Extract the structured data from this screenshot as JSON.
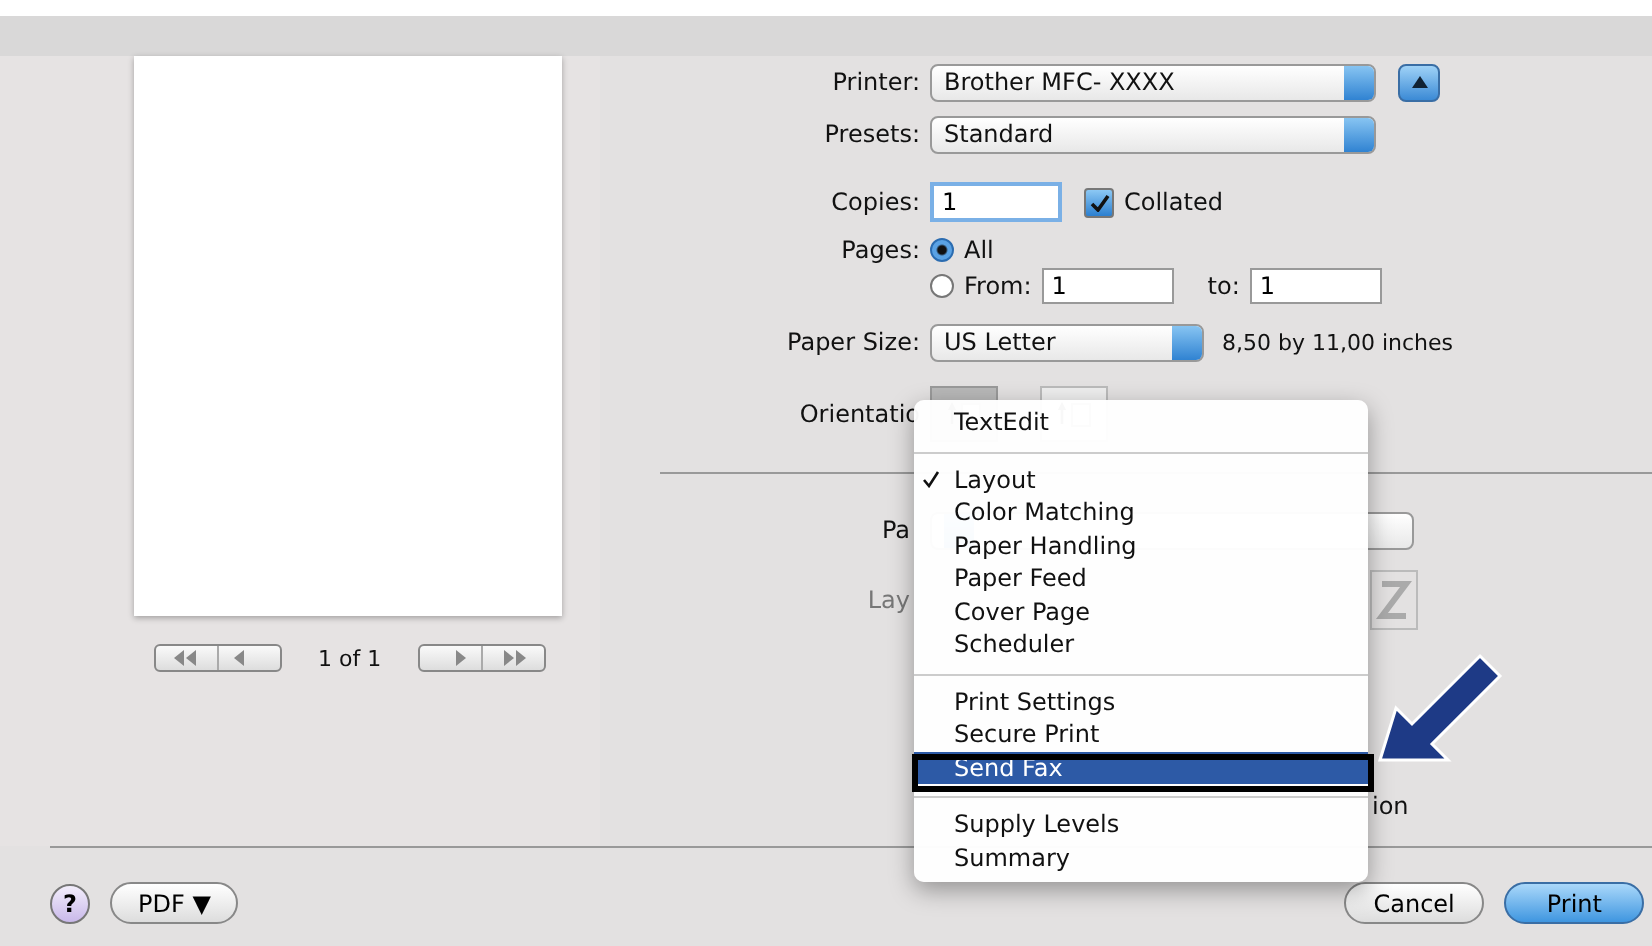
{
  "preview": {
    "page_indicator": "1 of 1"
  },
  "printer": {
    "label": "Printer:",
    "value": "Brother MFC- XXXX"
  },
  "presets": {
    "label": "Presets:",
    "value": "Standard"
  },
  "copies": {
    "label": "Copies:",
    "value": "1",
    "collated": {
      "label": "Collated",
      "checked": true
    }
  },
  "pages": {
    "label": "Pages:",
    "options": [
      {
        "label": "All",
        "selected": true
      },
      {
        "label": "From:",
        "selected": false
      }
    ],
    "from": "1",
    "to_label": "to:",
    "to": "1"
  },
  "paper_size": {
    "label": "Paper Size:",
    "value": "US Letter",
    "dimensions": "8,50 by 11,00 inches"
  },
  "orientation": {
    "label": "Orientatio",
    "options": [
      {
        "selected": true
      },
      {
        "selected": false
      }
    ]
  },
  "layout_section": {
    "pages_label": "Pa",
    "layout_label": "Lay",
    "reverse_label": "ion"
  },
  "menu": {
    "groups": [
      [
        {
          "label": "TextEdit",
          "checked": false,
          "selected": false
        }
      ],
      [
        {
          "label": "Layout",
          "checked": true,
          "selected": false
        },
        {
          "label": "Color Matching",
          "checked": false,
          "selected": false
        },
        {
          "label": "Paper Handling",
          "checked": false,
          "selected": false
        },
        {
          "label": "Paper Feed",
          "checked": false,
          "selected": false
        },
        {
          "label": "Cover Page",
          "checked": false,
          "selected": false
        },
        {
          "label": "Scheduler",
          "checked": false,
          "selected": false
        }
      ],
      [
        {
          "label": "Print Settings",
          "checked": false,
          "selected": false
        },
        {
          "label": "Secure Print",
          "checked": false,
          "selected": false
        },
        {
          "label": "Send Fax",
          "checked": false,
          "selected": true
        }
      ],
      [
        {
          "label": "Supply Levels",
          "checked": false,
          "selected": false
        },
        {
          "label": "Summary",
          "checked": false,
          "selected": false
        }
      ]
    ]
  },
  "footer": {
    "help": "?",
    "pdf": "PDF ▼",
    "cancel": "Cancel",
    "print": "Print"
  }
}
